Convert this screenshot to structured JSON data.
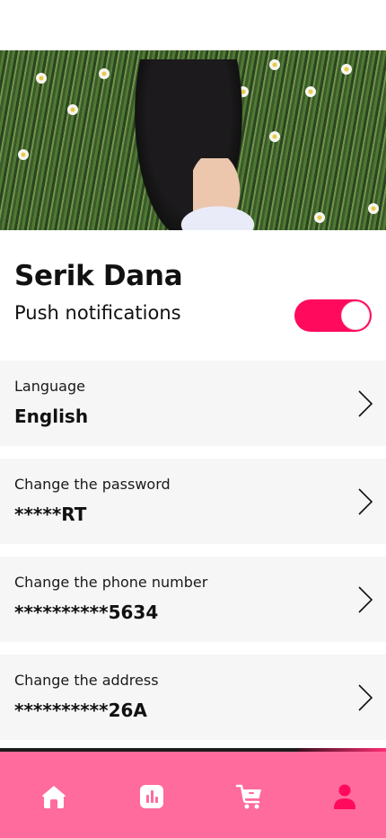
{
  "profile": {
    "name": "Serik Dana",
    "push_label": "Push notifications",
    "push_enabled": true
  },
  "settings": [
    {
      "title": "Language",
      "value": "English"
    },
    {
      "title": "Change the password",
      "value": "*****RT"
    },
    {
      "title": "Change the  phone number",
      "value": "**********5634"
    },
    {
      "title": "Change the  address",
      "value": "**********26A"
    }
  ],
  "tabbar": {
    "items": [
      "home-icon",
      "stats-icon",
      "cart-icon",
      "profile-icon"
    ],
    "active": "profile-icon"
  },
  "colors": {
    "accent": "#ff0a5c",
    "tabbar": "#ff6b9c",
    "row_bg": "#f6f6f6"
  }
}
